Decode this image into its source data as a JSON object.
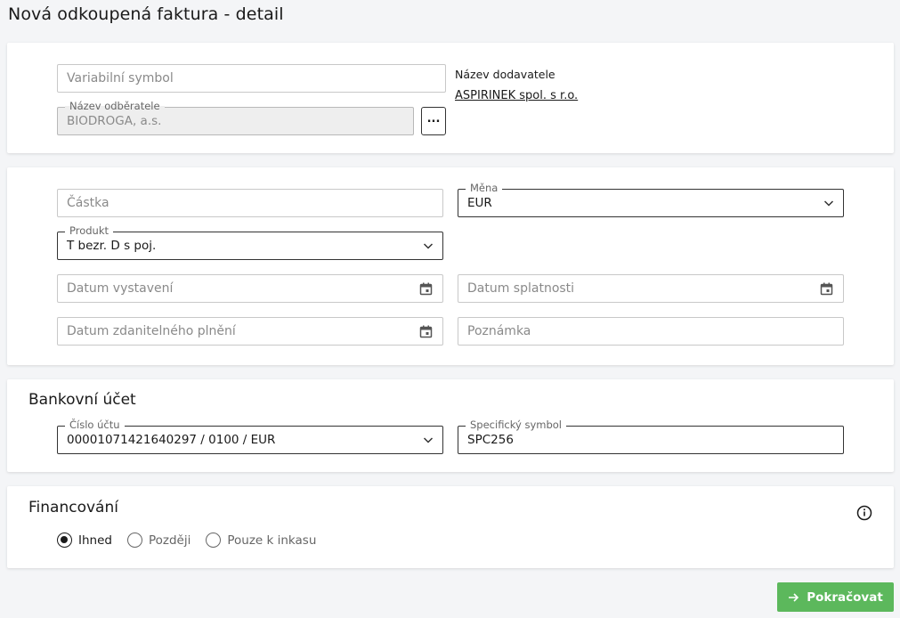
{
  "page": {
    "title": "Nová odkoupená faktura - detail"
  },
  "invoice": {
    "variable_symbol": {
      "placeholder": "Variabilní symbol",
      "value": ""
    },
    "customer": {
      "label": "Název odběratele",
      "value": "BIODROGA, a.s.",
      "picker_label": "..."
    },
    "supplier": {
      "label": "Název dodavatele",
      "value": "ASPIRINEK spol. s r.o."
    }
  },
  "details": {
    "amount": {
      "placeholder": "Částka",
      "value": ""
    },
    "currency": {
      "label": "Měna",
      "value": "EUR"
    },
    "product": {
      "label": "Produkt",
      "value": "T bezr. D s poj."
    },
    "issue_date": {
      "placeholder": "Datum vystavení"
    },
    "due_date": {
      "placeholder": "Datum splatnosti"
    },
    "taxable_date": {
      "placeholder": "Datum zdanitelného plnění"
    },
    "note": {
      "placeholder": "Poznámka"
    }
  },
  "bank": {
    "title": "Bankovní účet",
    "account": {
      "label": "Číslo účtu",
      "value": "00001071421640297 / 0100 / EUR"
    },
    "specific_symbol": {
      "label": "Specifický symbol",
      "value": "SPC256"
    }
  },
  "financing": {
    "title": "Financování",
    "options": [
      {
        "label": "Ihned",
        "checked": true
      },
      {
        "label": "Později",
        "checked": false
      },
      {
        "label": "Pouze k inkasu",
        "checked": false
      }
    ],
    "info_icon": "info-circle-icon"
  },
  "actions": {
    "continue_label": "Pokračovat",
    "continue_icon": "arrow-right-icon"
  },
  "colors": {
    "primary_button": "#5cb85c",
    "background": "#f4f5f7"
  }
}
